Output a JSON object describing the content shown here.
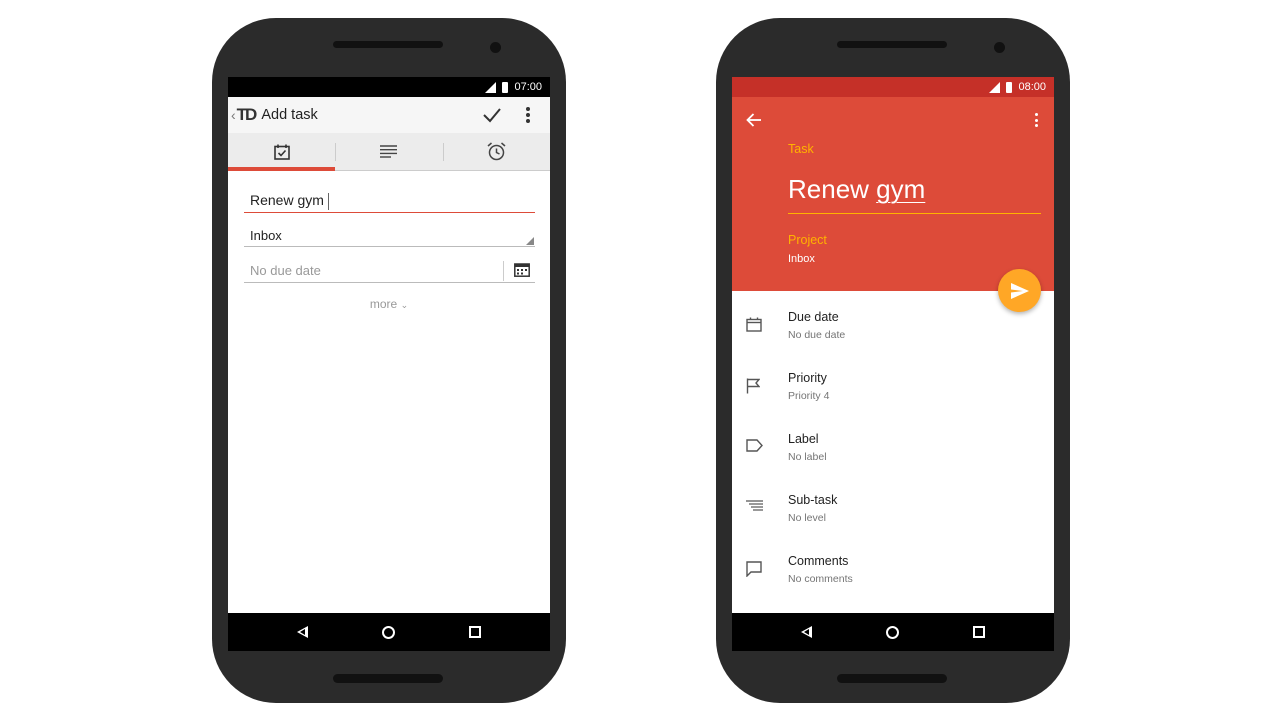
{
  "colors": {
    "accent_red": "#dd4b39",
    "statusbar_red": "#c53028",
    "amber": "#ffb300",
    "fab": "#ffa726"
  },
  "phone_old": {
    "status_time": "07:00",
    "action_bar": {
      "logo_text": "TD",
      "title": "Add task",
      "icons": [
        "check-icon",
        "overflow-menu-icon"
      ]
    },
    "tabs": [
      {
        "icon": "calendar-check-icon",
        "active": true
      },
      {
        "icon": "notes-icon",
        "active": false
      },
      {
        "icon": "alarm-clock-icon",
        "active": false
      }
    ],
    "form": {
      "task_name": "Renew gym",
      "project": "Inbox",
      "due_date_placeholder": "No due date",
      "more_label": "more"
    }
  },
  "phone_new": {
    "status_time": "08:00",
    "header": {
      "task_label": "Task",
      "task_name_first": "Renew",
      "task_name_second": "gym",
      "project_label": "Project",
      "project_value": "Inbox"
    },
    "fab_icon": "send-icon",
    "details": [
      {
        "icon": "calendar-icon",
        "title": "Due date",
        "subtitle": "No due date"
      },
      {
        "icon": "flag-icon",
        "title": "Priority",
        "subtitle": "Priority 4"
      },
      {
        "icon": "label-icon",
        "title": "Label",
        "subtitle": "No label"
      },
      {
        "icon": "subtask-icon",
        "title": "Sub-task",
        "subtitle": "No level"
      },
      {
        "icon": "comment-icon",
        "title": "Comments",
        "subtitle": "No comments"
      }
    ]
  }
}
